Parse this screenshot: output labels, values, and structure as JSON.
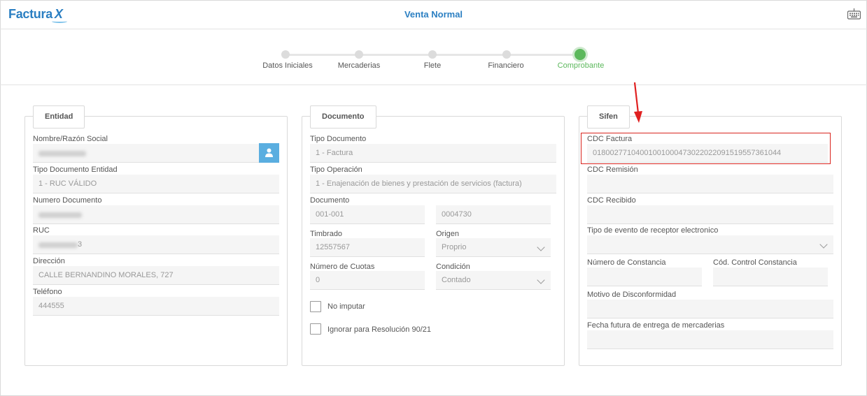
{
  "header": {
    "logo_text": "Factura",
    "logo_x": "X",
    "title": "Venta Normal",
    "keyboard_icon": "keyboard-icon"
  },
  "stepper": {
    "steps": [
      {
        "label": "Datos Iniciales",
        "active": false
      },
      {
        "label": "Mercaderias",
        "active": false
      },
      {
        "label": "Flete",
        "active": false
      },
      {
        "label": "Financiero",
        "active": false
      },
      {
        "label": "Comprobante",
        "active": true
      }
    ],
    "active_color": "#5cb85c"
  },
  "entidad": {
    "tab": "Entidad",
    "nombre_label": "Nombre/Razón Social",
    "nombre_value": "",
    "tipo_doc_label": "Tipo Documento Entidad",
    "tipo_doc_value": "1 - RUC VÁLIDO",
    "numero_doc_label": "Numero Documento",
    "ruc_label": "RUC",
    "ruc_visible_suffix": "3",
    "direccion_label": "Dirección",
    "direccion_value": "CALLE BERNANDINO MORALES, 727",
    "telefono_label": "Teléfono",
    "telefono_value": "444555",
    "user_icon": "user-icon"
  },
  "documento": {
    "tab": "Documento",
    "tipo_documento_label": "Tipo Documento",
    "tipo_documento_value": "1 - Factura",
    "tipo_operacion_label": "Tipo Operación",
    "tipo_operacion_value": "1 - Enajenación de bienes y prestación de servicios (factura)",
    "documento_label": "Documento",
    "documento_serie": "001-001",
    "documento_numero": "0004730",
    "timbrado_label": "Timbrado",
    "timbrado_value": "12557567",
    "origen_label": "Origen",
    "origen_value": "Proprio",
    "cuotas_label": "Número de Cuotas",
    "cuotas_value": "0",
    "condicion_label": "Condición",
    "condicion_value": "Contado",
    "no_imputar_label": "No imputar",
    "ignorar_label": "Ignorar para Resolución 90/21"
  },
  "sifen": {
    "tab": "Sifen",
    "cdc_factura_label": "CDC Factura",
    "cdc_factura_value": "01800277104001001000473022022091519557361044",
    "cdc_remision_label": "CDC Remisión",
    "cdc_recibido_label": "CDC Recibido",
    "tipo_evento_label": "Tipo de evento de receptor electronico",
    "numero_constancia_label": "Número de Constancia",
    "cod_control_label": "Cód. Control Constancia",
    "motivo_label": "Motivo de Disconformidad",
    "fecha_futura_label": "Fecha futura de entrega de mercaderias"
  },
  "annotation": {
    "highlight_color": "#d9241e"
  }
}
